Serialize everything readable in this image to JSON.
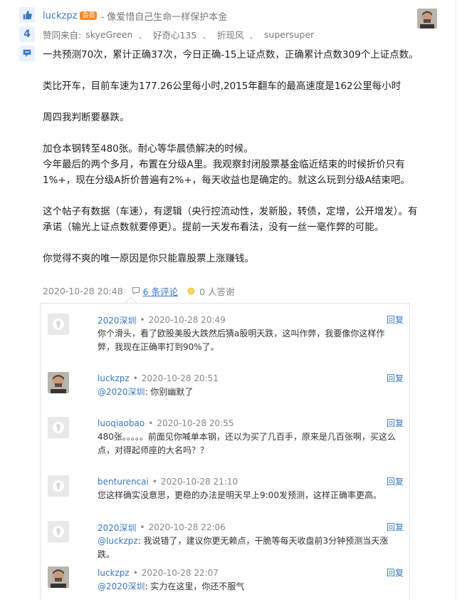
{
  "post": {
    "author": "luckzpz",
    "badge": "会员",
    "signature": "- 像爱惜自己生命一样保护本金",
    "like_count": "4",
    "likes_prefix": "赞同来自:",
    "likers": [
      "skyeGreen",
      "好奇心135",
      "折现风",
      "supersuper"
    ],
    "likers_sep": "、",
    "paragraphs": [
      [
        "一共预测70次，累计正确37次，今日正确-15上证点数，正确累计点数309个上证点数。"
      ],
      [
        "类比开车，目前车速为177.26公里每小时,2015年翻车的最高速度是162公里每小时"
      ],
      [
        "周四我判断要暴跌。"
      ],
      [
        "加仓本钢转至480张。耐心等华晨债解决的时候。",
        "今年最后的两个多月，布置在分级A里。我观察封闭股票基金临近结束的时候折价只有1%+，现在分级A折价普遍有2%+，每天收益也是确定的。就这么玩到分级A结束吧。"
      ],
      [
        "这个帖子有数据（车速），有逻辑（央行控流动性，发新股，转债，定增，公开增发）。有承诺（输光上证点数就要停更）。提前一天发布看法，没有一丝一毫作弊的可能。"
      ],
      [
        "你觉得不爽的唯一原因是你只能靠股票上涨赚钱。"
      ]
    ],
    "timestamp": "2020-10-28 20:48",
    "comment_count_label": "6 条评论",
    "tip_label": "0 人答谢"
  },
  "comments": [
    {
      "user": "2020深圳",
      "time": "2020-10-28 20:49",
      "reply": "回复",
      "avatar": "default",
      "mention": "",
      "text": "你个滑头，看了欧股美股大跌然后猜a股明天跌，这叫作弊，我要像你这样作弊，我现在正确率打到90%了。"
    },
    {
      "user": "luckzpz",
      "time": "2020-10-28 20:51",
      "reply": "回复",
      "avatar": "photo",
      "mention": "@2020深圳",
      "text": ": 你别幽默了"
    },
    {
      "user": "luoqiaobao",
      "time": "2020-10-28 20:55",
      "reply": "回复",
      "avatar": "default",
      "mention": "",
      "text": "480张。。。。。前面见你喊单本钢，还以为买了几百手，原来是几百张啊，买这么点，对得起师座的大名吗？？"
    },
    {
      "user": "benturencai",
      "time": "2020-10-28 21:10",
      "reply": "回复",
      "avatar": "default",
      "mention": "",
      "text": "您这样确实没意思，更稳的办法是明天早上9:00发预测，这样正确率更高。"
    },
    {
      "user": "2020深圳",
      "time": "2020-10-28 22:06",
      "reply": "回复",
      "avatar": "default",
      "mention": "@luckzpz",
      "text": ": 我说错了，建议你更无赖点，干脆等每天收盘前3分钟预测当天涨跌。"
    },
    {
      "user": "luckzpz",
      "time": "2020-10-28 22:07",
      "reply": "回复",
      "avatar": "photo",
      "mention": "@2020深圳",
      "text": ": 实力在这里，你还不服气"
    }
  ],
  "colors": {
    "link": "#3a78c3",
    "badge": "#f28a2a",
    "meta": "#888888"
  }
}
